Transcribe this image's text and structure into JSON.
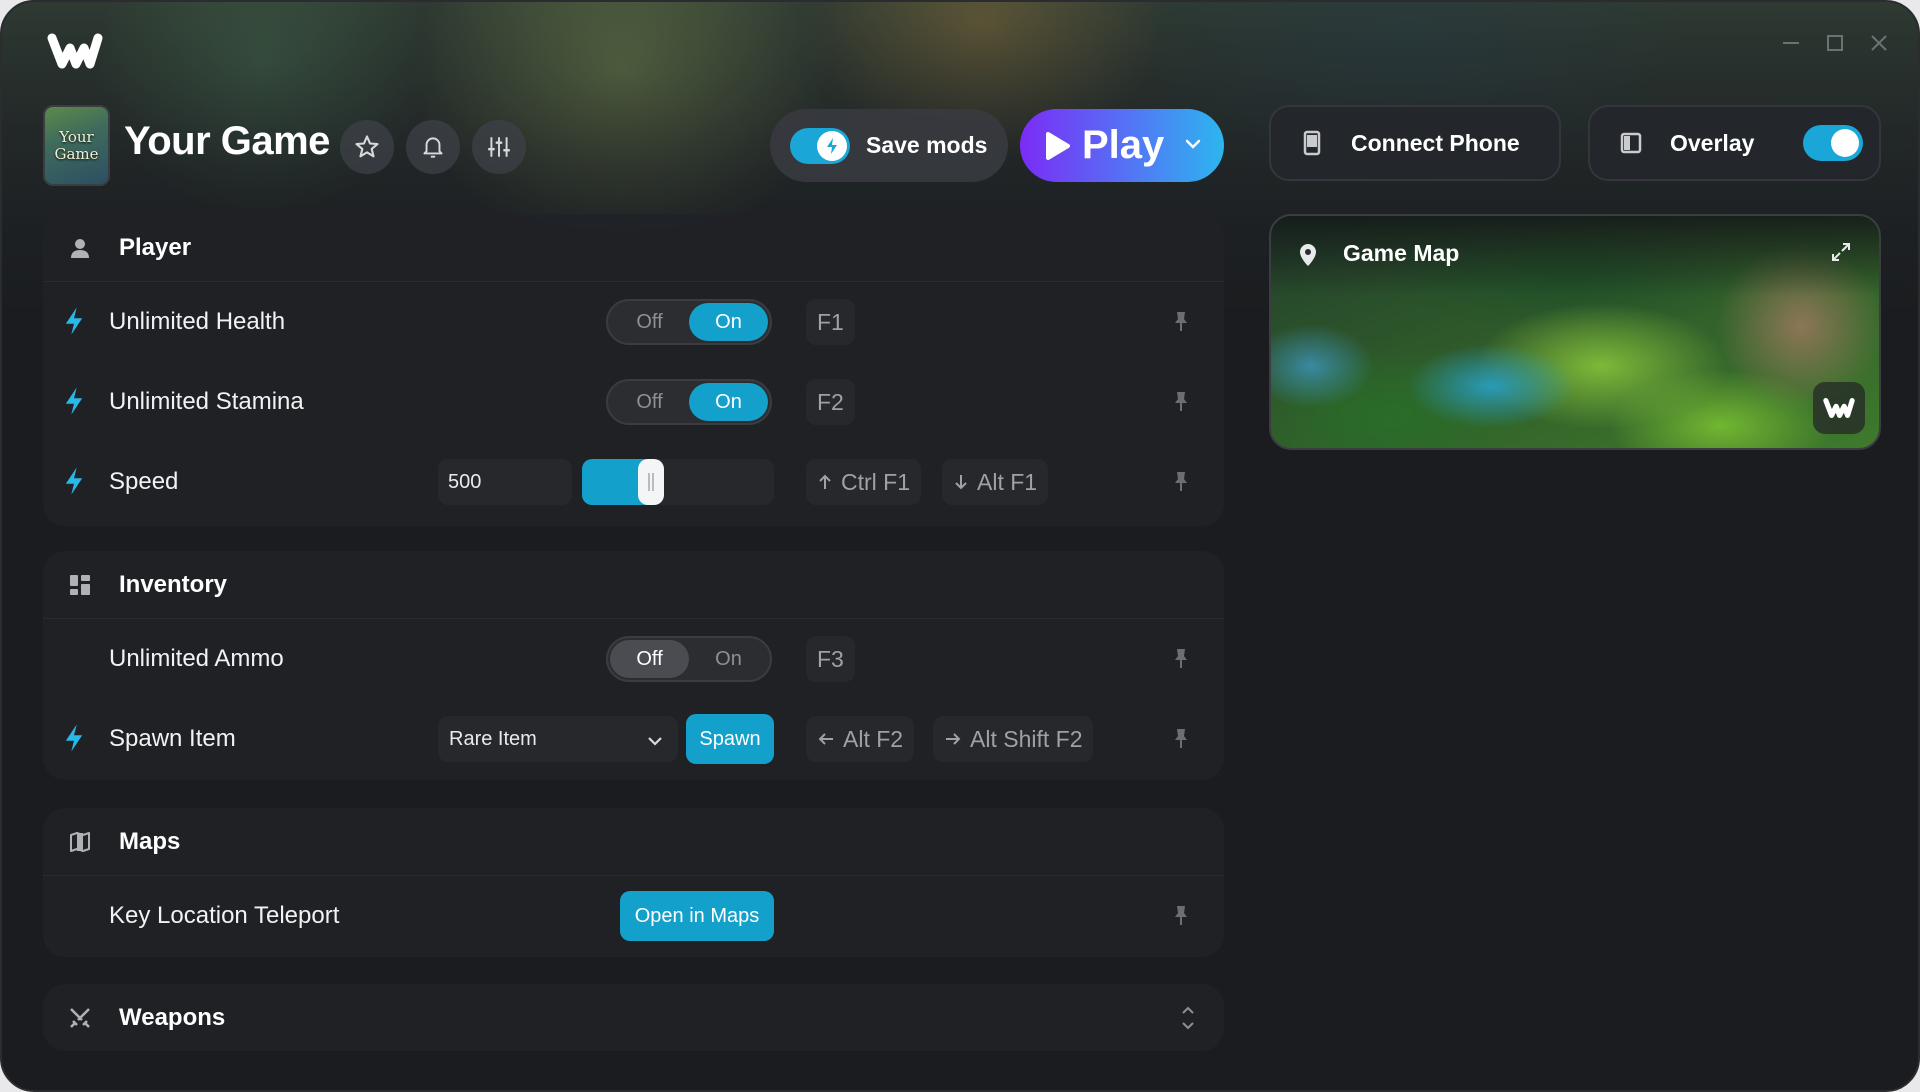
{
  "app": {
    "logo_icon": "wemod-logo-icon"
  },
  "window_controls": [
    "minimize-icon",
    "maximize-icon",
    "close-icon"
  ],
  "game": {
    "title": "Your Game",
    "thumbnail_text": "Your Game"
  },
  "header_buttons": [
    "star-icon",
    "bell-icon",
    "sliders-icon"
  ],
  "save_mods": {
    "label": "Save mods",
    "enabled": true
  },
  "play": {
    "label": "Play"
  },
  "connect_phone": {
    "label": "Connect Phone"
  },
  "overlay": {
    "label": "Overlay",
    "enabled": true
  },
  "game_map": {
    "title": "Game Map"
  },
  "sections": {
    "player": {
      "title": "Player",
      "rows": {
        "unlimited_health": {
          "label": "Unlimited Health",
          "off": "Off",
          "on": "On",
          "state": "on",
          "hotkey": "F1"
        },
        "unlimited_stamina": {
          "label": "Unlimited Stamina",
          "off": "Off",
          "on": "On",
          "state": "on",
          "hotkey": "F2"
        },
        "speed": {
          "label": "Speed",
          "value": "500",
          "slider_fraction": 0.34,
          "hotkey_up": "Ctrl F1",
          "hotkey_down": "Alt F1"
        }
      }
    },
    "inventory": {
      "title": "Inventory",
      "rows": {
        "unlimited_ammo": {
          "label": "Unlimited Ammo",
          "off": "Off",
          "on": "On",
          "state": "off",
          "hotkey": "F3"
        },
        "spawn_item": {
          "label": "Spawn Item",
          "selected": "Rare Item",
          "button": "Spawn",
          "hotkey_prev": "Alt F2",
          "hotkey_next": "Alt Shift F2"
        }
      }
    },
    "maps": {
      "title": "Maps",
      "rows": {
        "key_location_teleport": {
          "label": "Key Location Teleport",
          "button": "Open in Maps"
        }
      }
    },
    "weapons": {
      "title": "Weapons"
    }
  },
  "colors": {
    "accent": "#13a0ca",
    "bolt": "#2ab8e8",
    "play_gradient_start": "#7b2cf5",
    "play_gradient_end": "#2bb6ee"
  }
}
